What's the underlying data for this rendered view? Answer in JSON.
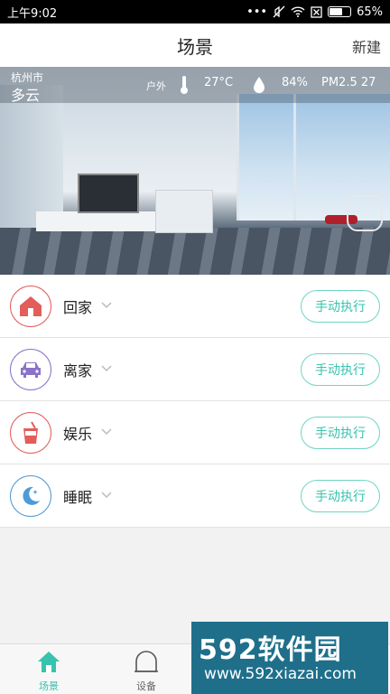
{
  "status": {
    "time": "上午9:02",
    "battery": "65%"
  },
  "header": {
    "title": "场景",
    "new_label": "新建"
  },
  "weather": {
    "city": "杭州市",
    "condition": "多云",
    "location_label": "户外",
    "temperature": "27°C",
    "humidity": "84%",
    "pm25": "PM2.5 27"
  },
  "scenes": [
    {
      "name": "回家",
      "icon": "home-icon",
      "color": "#e35d5b",
      "action": "手动执行"
    },
    {
      "name": "离家",
      "icon": "car-icon",
      "color": "#8a72c9",
      "action": "手动执行"
    },
    {
      "name": "娱乐",
      "icon": "drink-icon",
      "color": "#e35d5b",
      "action": "手动执行"
    },
    {
      "name": "睡眠",
      "icon": "moon-icon",
      "color": "#4f9ad8",
      "action": "手动执行"
    }
  ],
  "tabs": [
    {
      "label": "场景",
      "icon": "home-icon",
      "active": true
    },
    {
      "label": "设备",
      "icon": "device-icon",
      "active": false
    },
    {
      "label": "",
      "icon": "",
      "active": false
    },
    {
      "label": "",
      "icon": "",
      "active": false
    }
  ],
  "watermark": {
    "brand": "592软件园",
    "url": "www.592xiazai.com"
  },
  "colors": {
    "accent": "#38c3ae",
    "border_accent": "#6fd5c4"
  }
}
